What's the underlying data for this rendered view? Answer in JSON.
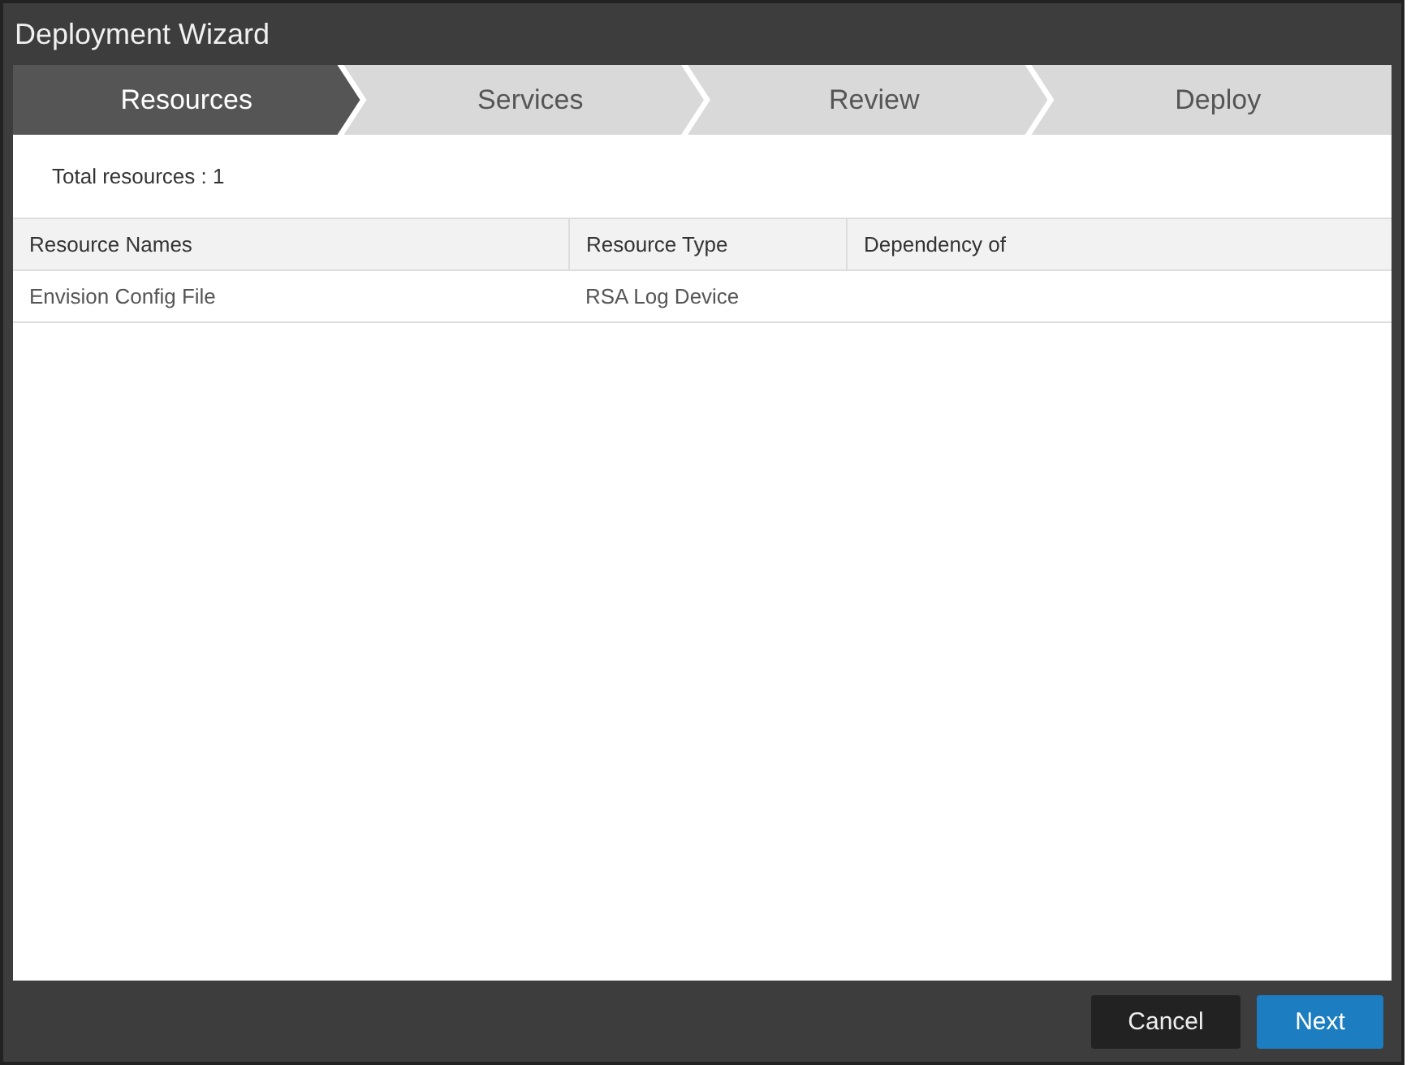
{
  "window": {
    "title": "Deployment Wizard"
  },
  "steps": [
    {
      "label": "Resources",
      "selected": true
    },
    {
      "label": "Services",
      "selected": false
    },
    {
      "label": "Review",
      "selected": false
    },
    {
      "label": "Deploy",
      "selected": false
    }
  ],
  "summary": "Total resources : 1",
  "table": {
    "columns": [
      "Resource Names",
      "Resource Type",
      "Dependency of"
    ],
    "rows": [
      [
        "Envision Config File",
        "RSA Log Device",
        ""
      ]
    ]
  },
  "buttons": [
    {
      "label": "Cancel",
      "kind": "secondary"
    },
    {
      "label": "Next",
      "kind": "primary"
    }
  ]
}
